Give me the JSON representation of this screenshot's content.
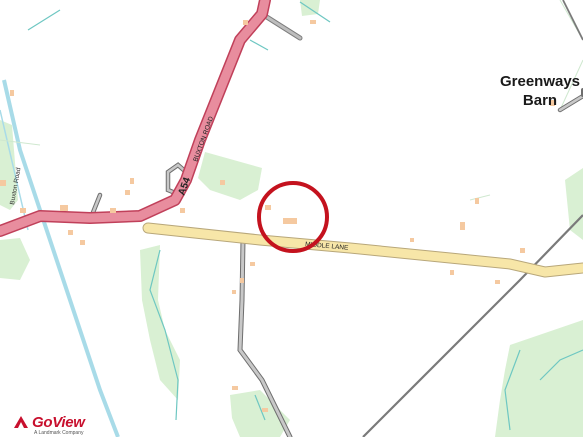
{
  "map": {
    "place_name_line1": "Greenways",
    "place_name_line2": "Barn",
    "road_labels": {
      "a_road_number": "A54",
      "a_road_name": "BUXTON ROAD",
      "lane_name": "MIDDLE LANE",
      "side_road_name": "Buxton Road"
    },
    "colors": {
      "a_road": "#e88d9e",
      "a_road_casing": "#c0405a",
      "minor_road": "#f7e6a8",
      "minor_road_casing": "#b8a77a",
      "track": "#9c9c9c",
      "woodland": "#d9f0d3",
      "water": "#a8dbe8",
      "building": "#f5c9a0",
      "marker_ring": "#c4121e"
    }
  },
  "branding": {
    "logo_text": "GoView",
    "logo_subtext": "A Landmark Company",
    "icon": "goview-logo-icon"
  }
}
